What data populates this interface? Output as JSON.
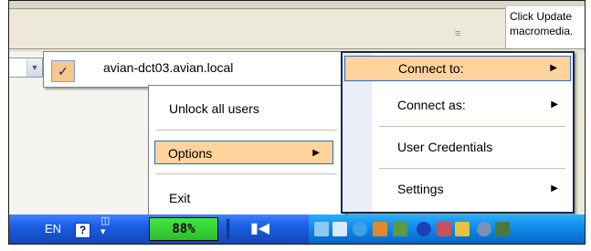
{
  "background": {
    "notice": [
      "Click Update",
      "macromedia."
    ]
  },
  "host_menu": {
    "label": "avian-dct03.avian.local",
    "checked": true
  },
  "options_menu": {
    "items": [
      {
        "label": "Unlock all users",
        "submenu": false
      },
      {
        "label": "Options",
        "submenu": true,
        "highlighted": true
      },
      {
        "label": "Exit",
        "submenu": false
      }
    ]
  },
  "main_menu": {
    "items": [
      {
        "label": "Connect to:",
        "submenu": true,
        "highlighted": true
      },
      {
        "label": "Connect as:",
        "submenu": true
      },
      {
        "label": "User Credentials",
        "submenu": false
      },
      {
        "label": "Settings",
        "submenu": true
      }
    ]
  },
  "taskbar": {
    "language": "EN",
    "battery_percent": "88%",
    "tray_icons": [
      "network-icon",
      "volume-icon",
      "sync-icon",
      "chart-icon",
      "display-icon",
      "bluetooth-icon",
      "security-shield-icon",
      "windows-flag-icon",
      "search-icon",
      "help-icon"
    ]
  },
  "colors": {
    "highlight": "#ffd39b",
    "highlight_border": "#3169c6",
    "taskbar_blue": "#1a5ee3",
    "tray_blue": "#0f8be8",
    "battery_green": "#2cbf2c"
  }
}
